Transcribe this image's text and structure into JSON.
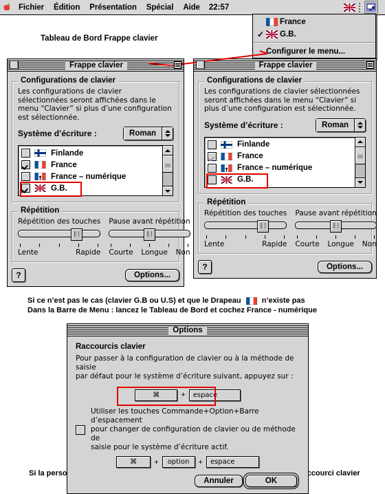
{
  "menubar": {
    "apple_icon": "apple-logo",
    "items": [
      "Fichier",
      "Édition",
      "Présentation",
      "Spécial",
      "Aide"
    ],
    "clock": "22:57",
    "flag_icon": "uk-flag-icon",
    "app_icon": "keyboard-menu-icon"
  },
  "popup_menu": {
    "items": [
      {
        "label": "France",
        "flag": "fr-flag-icon",
        "checked": false
      },
      {
        "label": "G.B.",
        "flag": "uk-flag-icon",
        "checked": true
      }
    ],
    "config_item": "Configurer le menu..."
  },
  "caption_top": "Tableau de Bord Frappe clavier",
  "caption_middle_line1": "Si ce n’est pas le cas (clavier G.B ou U.S) et que le Drapeau",
  "caption_middle_line1_end": "n’existe pas",
  "caption_middle_line2": "Dans la Barre de Menu : lancez le Tableau de Bord et cochez France - numérique",
  "caption_bottom": "Si la personne veut conserver les deux possibilités Fr & GB, indiquez-lui le raccourci clavier",
  "window_left": {
    "title": "Frappe clavier",
    "group_config_title": "Configurations de clavier",
    "group_config_desc": "Les configurations de clavier sélectionnées seront affichées dans le menu “Clavier” si plus d’une configuration est sélectionnée.",
    "script_label": "Système d’écriture :",
    "script_value": "Roman",
    "list": [
      {
        "label": "Finlande",
        "flag": "fi-flag-icon",
        "checked": false,
        "dim": false,
        "highlight": false
      },
      {
        "label": "France",
        "flag": "fr-flag-icon",
        "checked": true,
        "dim": false,
        "highlight": false
      },
      {
        "label": "France – numérique",
        "flag": "fr-num-flag-icon",
        "checked": false,
        "dim": false,
        "highlight": false
      },
      {
        "label": "G.B.",
        "flag": "uk-flag-icon",
        "checked": true,
        "dim": false,
        "highlight": true
      }
    ],
    "group_repeat_title": "Répétition",
    "slider1_label": "Répétition des touches",
    "slider1_min": "Lente",
    "slider1_max": "Rapide",
    "slider2_label": "Pause avant répétition",
    "slider2_min": "Courte",
    "slider2_mid": "Longue",
    "slider2_max": "Non",
    "help_label": "?",
    "options_button": "Options..."
  },
  "window_right": {
    "title": "Frappe clavier",
    "group_config_title": "Configurations de clavier",
    "group_config_desc": "Les configurations de clavier sélectionnées seront affichées dans le menu “Clavier” si plus d’une configuration est sélectionnée.",
    "script_label": "Système d’écriture :",
    "script_value": "Roman",
    "list": [
      {
        "label": "Finlande",
        "flag": "fi-flag-icon",
        "checked": false,
        "dim": false,
        "highlight": false
      },
      {
        "label": "France",
        "flag": "fr-flag-icon",
        "checked": true,
        "dim": true,
        "highlight": false
      },
      {
        "label": "France – numérique",
        "flag": "fr-num-flag-icon",
        "checked": false,
        "dim": false,
        "highlight": false
      },
      {
        "label": "G.B.",
        "flag": "uk-flag-icon",
        "checked": false,
        "dim": false,
        "highlight": true
      }
    ],
    "group_repeat_title": "Répétition",
    "slider1_label": "Répétition des touches",
    "slider1_min": "Lente",
    "slider1_max": "Rapide",
    "slider2_label": "Pause avant répétition",
    "slider2_min": "Courte",
    "slider2_mid": "Longue",
    "slider2_max": "Non",
    "help_label": "?",
    "options_button": "Options..."
  },
  "options_dialog": {
    "title": "Options",
    "section_title": "Raccourcis clavier",
    "desc_line1": "Pour passer à la configuration de clavier ou à la méthode de saisie",
    "desc_line2": "par défaut pour le système d’écriture suivant, appuyez sur :",
    "shortcut1_key1": "⌘",
    "shortcut1_plus": "+",
    "shortcut1_key2": "espace",
    "checkbox_checked": false,
    "cb_line1": "Utiliser les touches Commande+Option+Barre d’espacement",
    "cb_line2": "pour changer de configuration de clavier ou de méthode de",
    "cb_line3": "saisie pour le système d’écriture actif.",
    "shortcut2_key1": "⌘",
    "shortcut2_plus1": "+",
    "shortcut2_key2": "option",
    "shortcut2_plus2": "+",
    "shortcut2_key3": "espace",
    "cancel_button": "Annuler",
    "ok_button": "OK"
  },
  "colors": {
    "highlight_red": "#e00000",
    "window_gray": "#d4d4d4",
    "arrow_red": "#e00000"
  }
}
